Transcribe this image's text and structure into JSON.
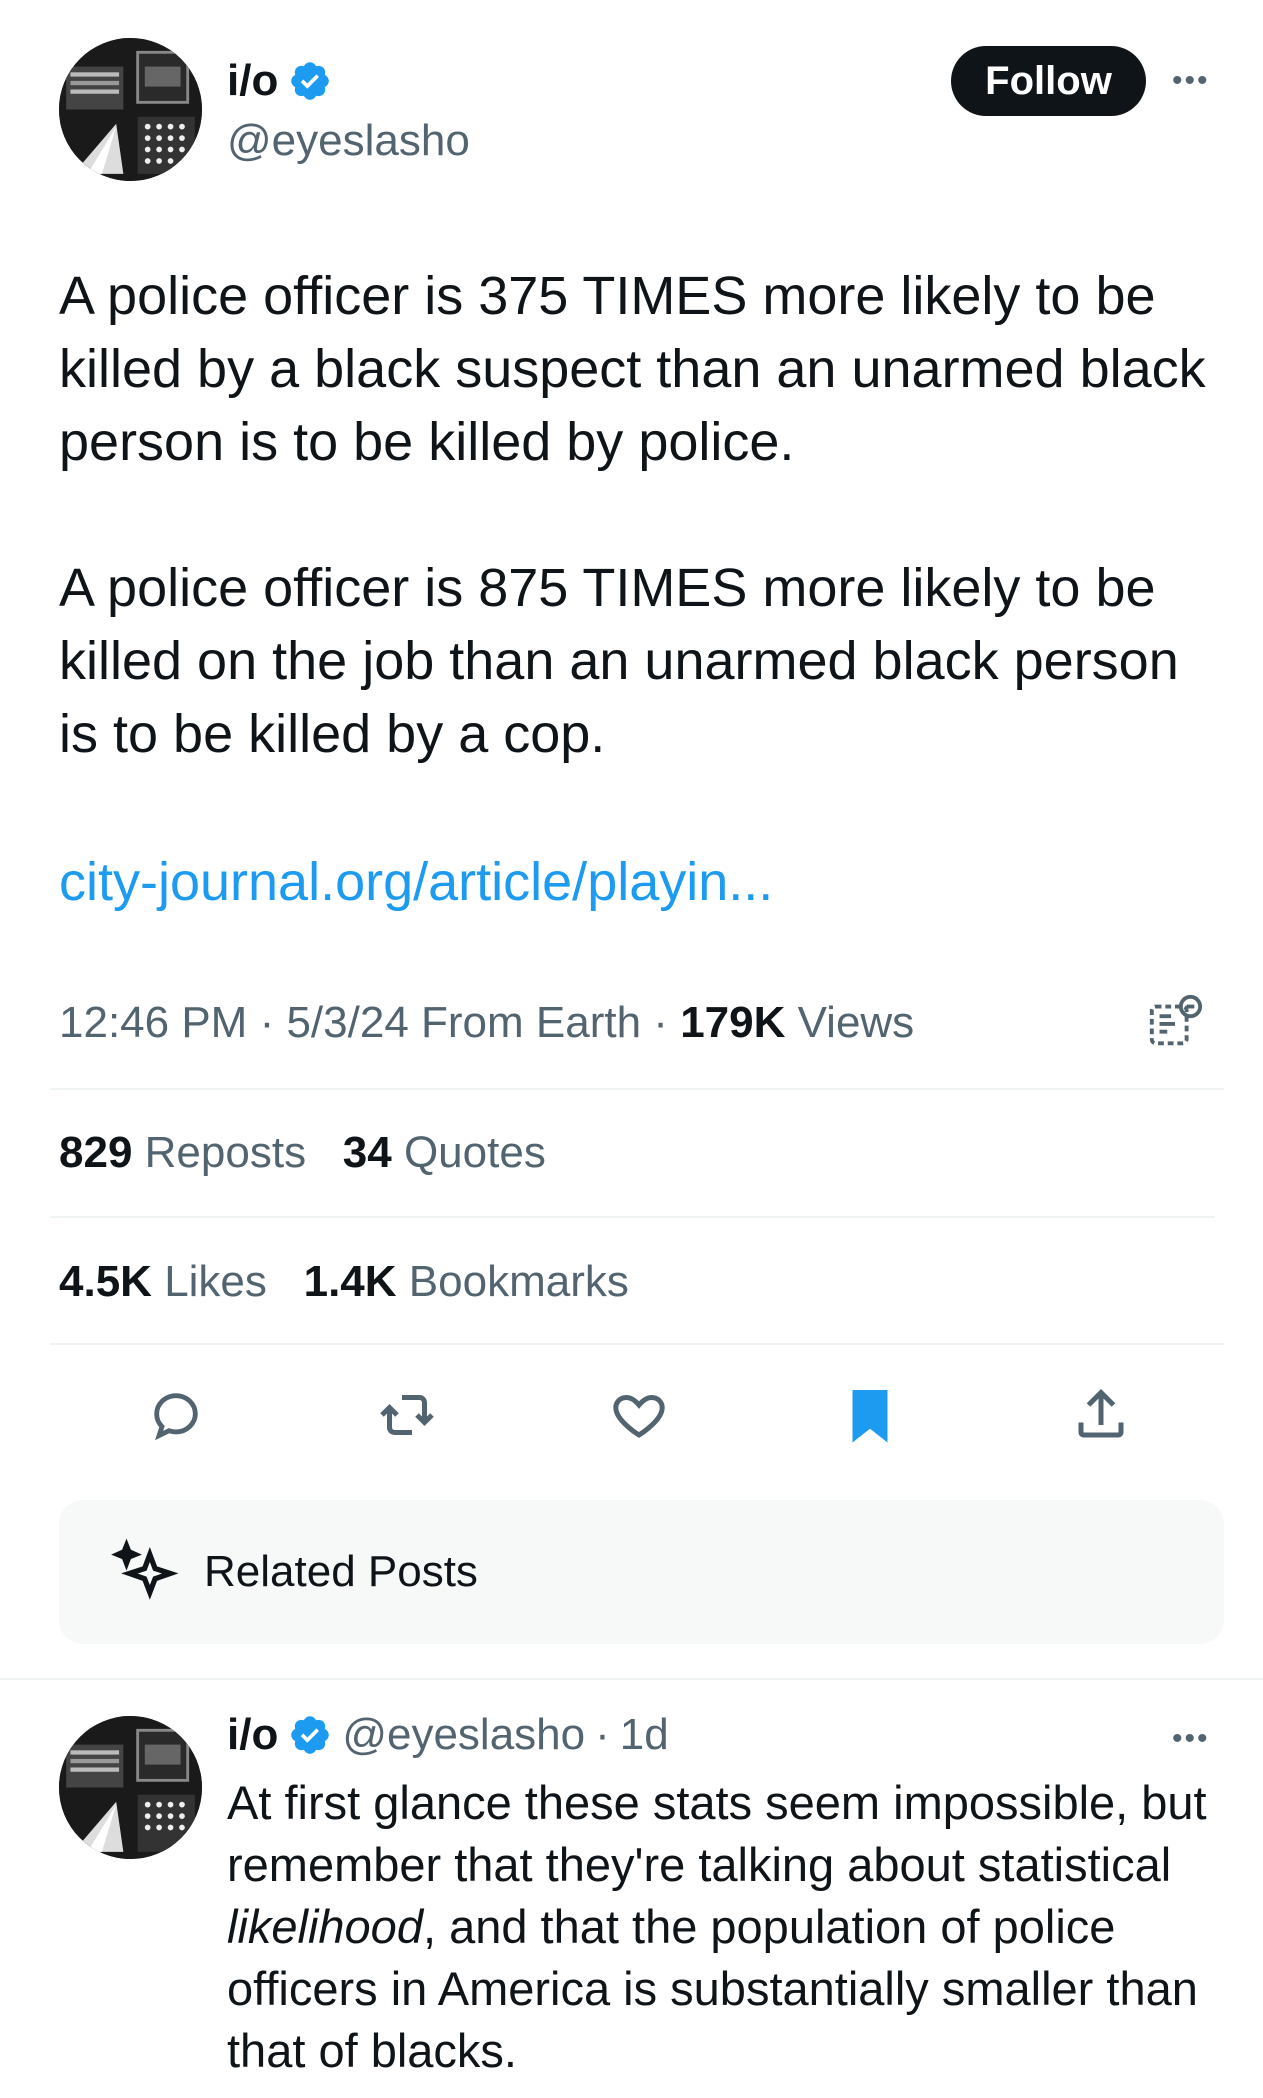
{
  "tweet": {
    "author": {
      "name": "i/o",
      "handle": "@eyeslasho"
    },
    "follow_label": "Follow",
    "more_label": "•••",
    "paragraph1": "A police officer is 375 TIMES more likely to be killed by a black suspect than an unarmed black person is to be killed by police.",
    "paragraph2": "A police officer is 875 TIMES more likely to be killed on the job than an unarmed black person is to be killed by a cop.",
    "link": "city-journal.org/article/playin...",
    "time": "12:46 PM",
    "date": "5/3/24",
    "source": "From Earth",
    "views_count": "179K",
    "views_label": "Views",
    "reposts_count": "829",
    "reposts_label": "Reposts",
    "quotes_count": "34",
    "quotes_label": "Quotes",
    "likes_count": "4.5K",
    "likes_label": "Likes",
    "bookmarks_count": "1.4K",
    "bookmarks_label": "Bookmarks",
    "icons": [
      "reply-icon",
      "repost-icon",
      "like-icon",
      "bookmark-icon",
      "share-icon",
      "grok-analyze-icon"
    ],
    "accent_color": "#1d9bf0"
  },
  "related": {
    "label": "Related Posts"
  },
  "reply": {
    "name": "i/o",
    "handle": "@eyeslasho",
    "separator": "·",
    "age": "1d",
    "text_before": "At first glance these stats seem impossible, but remember that they're talking about statistical ",
    "text_italic": "likelihood",
    "text_after": ", and that the population of police officers in America is substantially smaller than that of blacks.",
    "more_label": "•••"
  }
}
